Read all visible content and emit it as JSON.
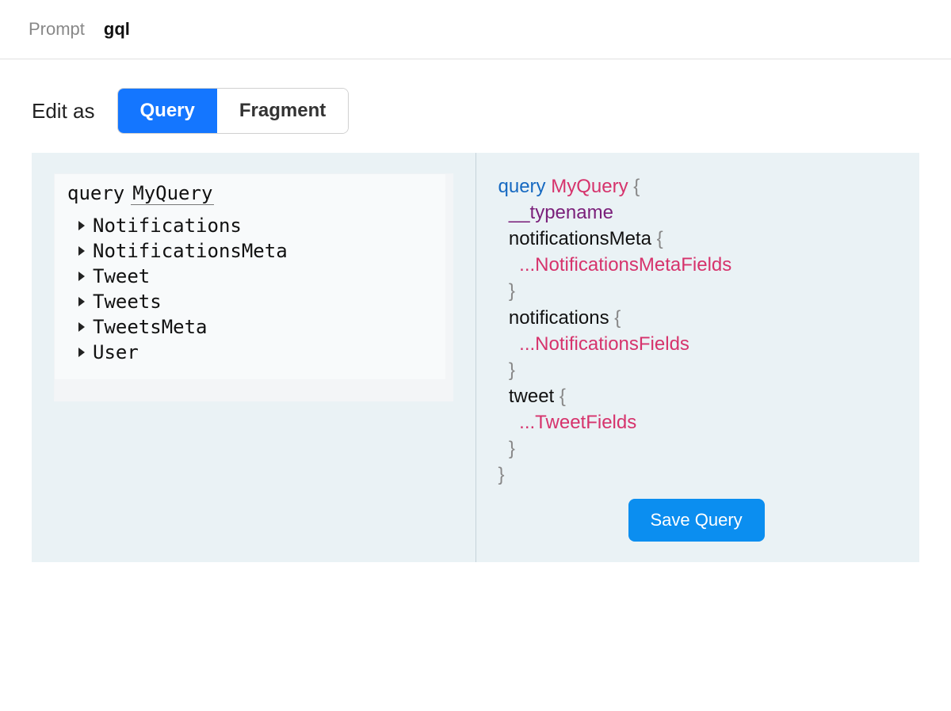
{
  "breadcrumb": {
    "root": "Prompt",
    "current": "gql"
  },
  "toolbar": {
    "edit_as_label": "Edit as",
    "tabs": {
      "query": "Query",
      "fragment": "Fragment"
    }
  },
  "explorer": {
    "keyword": "query",
    "query_name": "MyQuery",
    "items": [
      {
        "label": "Notifications"
      },
      {
        "label": "NotificationsMeta"
      },
      {
        "label": "Tweet"
      },
      {
        "label": "Tweets"
      },
      {
        "label": "TweetsMeta"
      },
      {
        "label": "User"
      }
    ]
  },
  "preview": {
    "keyword": "query",
    "query_name": "MyQuery",
    "brace_open": "{",
    "brace_close": "}",
    "typename": "__typename",
    "fields": [
      {
        "name": "notificationsMeta",
        "fragment": "...NotificationsMetaFields"
      },
      {
        "name": "notifications",
        "fragment": "...NotificationsFields"
      },
      {
        "name": "tweet",
        "fragment": "...TweetFields"
      }
    ],
    "save_button": "Save Query"
  }
}
